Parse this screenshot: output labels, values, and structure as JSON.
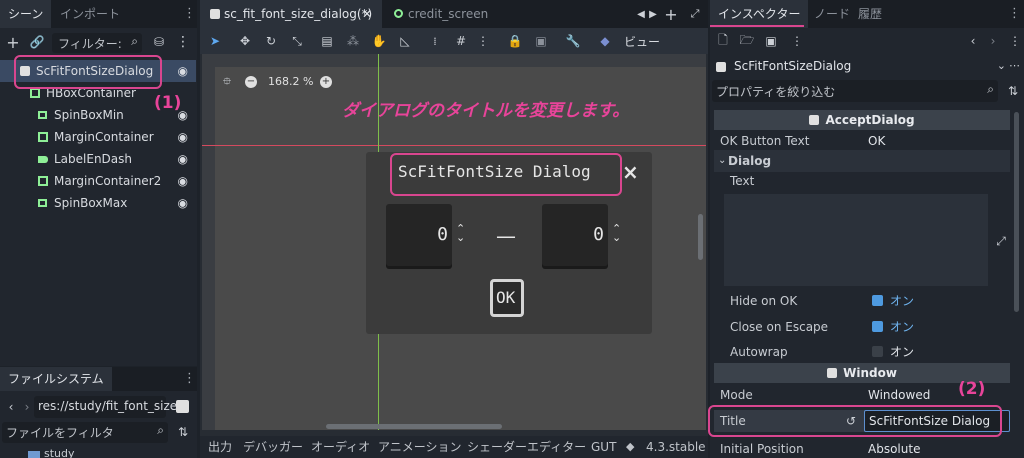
{
  "left_dock": {
    "tabs": [
      "シーン",
      "インポート"
    ],
    "filter_placeholder": "フィルター:",
    "tree": [
      {
        "label": "ScFitFontSizeDialog",
        "icon": "dialog-icon",
        "color": "#e0e0e0"
      },
      {
        "label": "HBoxContainer",
        "icon": "hbox-icon",
        "color": "#8eef97"
      },
      {
        "label": "SpinBoxMin",
        "icon": "spinbox-icon",
        "color": "#8eef97"
      },
      {
        "label": "MarginContainer",
        "icon": "margin-container-icon",
        "color": "#8eef97"
      },
      {
        "label": "LabelEnDash",
        "icon": "label-icon",
        "color": "#8eef97"
      },
      {
        "label": "MarginContainer2",
        "icon": "margin-container-icon",
        "color": "#8eef97"
      },
      {
        "label": "SpinBoxMax",
        "icon": "spinbox-icon",
        "color": "#8eef97"
      }
    ]
  },
  "filesystem": {
    "tab": "ファイルシステム",
    "path": "res://study/fit_font_size/",
    "filter_placeholder": "ファイルをフィルタ",
    "partial_item": "study"
  },
  "editor": {
    "tabs": [
      "sc_fit_font_size_dialog(*)",
      "credit_screen"
    ],
    "view_label": "ビュー",
    "zoom": "168.2 %",
    "bottom_tabs": [
      "出力",
      "デバッガー",
      "オーディオ",
      "アニメーション",
      "シェーダーエディター",
      "GUT"
    ],
    "version": "4.3.stable"
  },
  "dialog_preview": {
    "title": "ScFitFontSize Dialog",
    "min_value": "0",
    "dash": "—",
    "max_value": "0",
    "ok_label": "OK"
  },
  "annotations": {
    "caption": "ダイアログのタイトルを変更します。",
    "label1": "(1)",
    "label2": "(2)",
    "accent": "#e8449a"
  },
  "inspector": {
    "tabs": [
      "インスペクター",
      "ノード",
      "履歴"
    ],
    "node_name": "ScFitFontSizeDialog",
    "filter_placeholder": "プロパティを絞り込む",
    "sections": {
      "accept": "AcceptDialog",
      "dialog": "Dialog",
      "window": "Window"
    },
    "ok_button_text_key": "OK Button Text",
    "ok_button_text_value": "OK",
    "text_key": "Text",
    "hide_on_ok_key": "Hide on OK",
    "hide_on_ok_value": "オン",
    "close_on_escape_key": "Close on Escape",
    "close_on_escape_value": "オン",
    "autowrap_key": "Autowrap",
    "autowrap_value": "オン",
    "mode_key": "Mode",
    "mode_value": "Windowed",
    "title_key": "Title",
    "title_value": "ScFitFontSize Dialog",
    "initial_position_key": "Initial Position",
    "initial_position_value": "Absolute"
  }
}
